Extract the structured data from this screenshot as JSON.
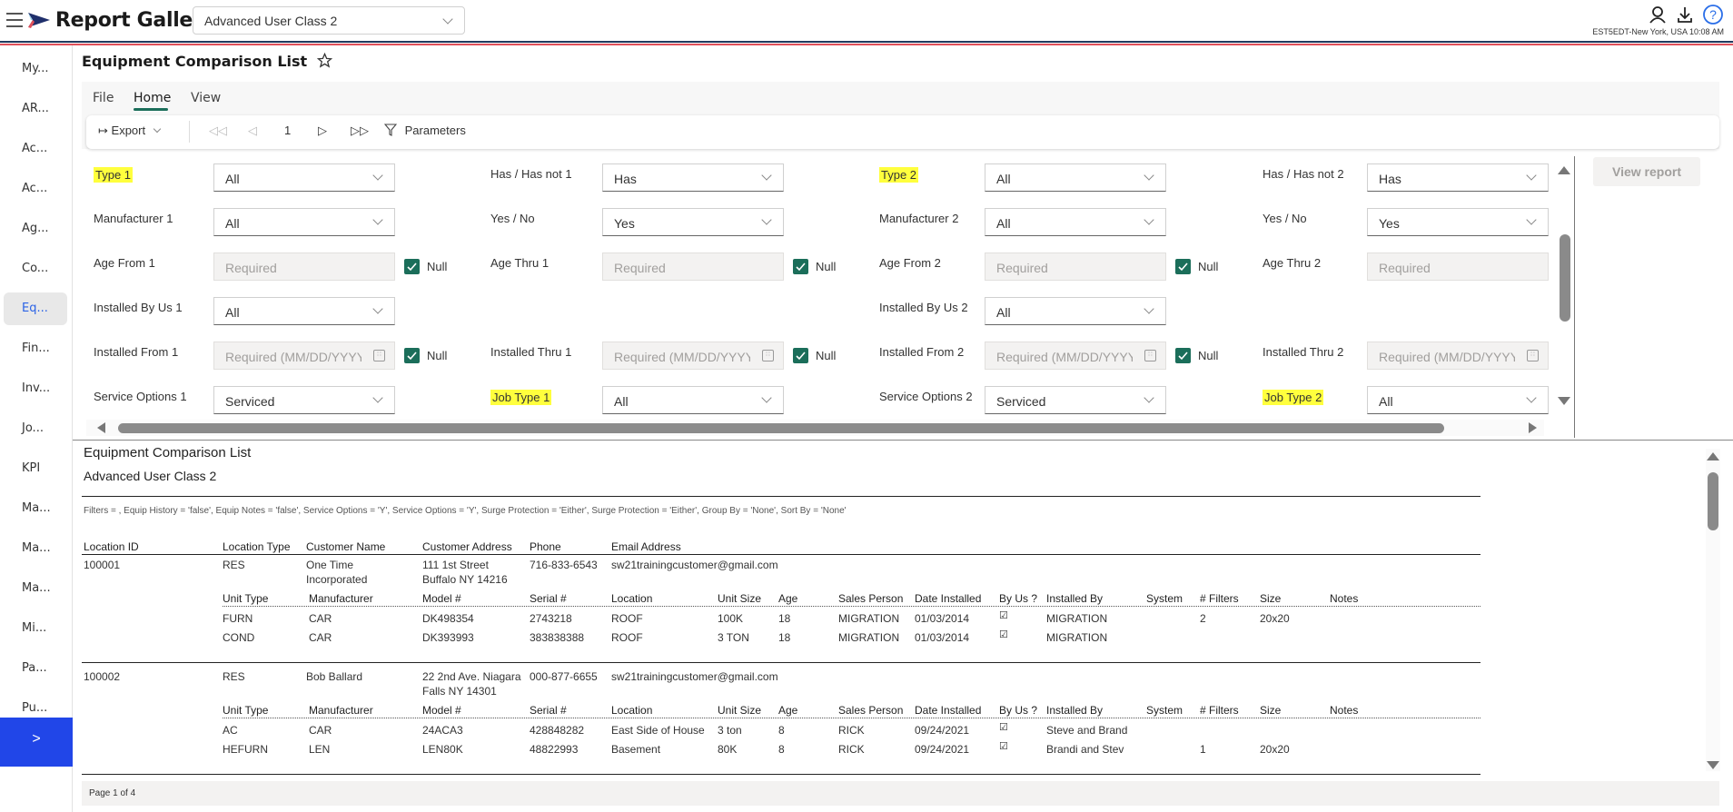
{
  "header": {
    "app_title": "Report Gallery",
    "report_select_value": "Advanced User Class 2",
    "timezone_clock": "EST5EDT-New York, USA 10:08 AM",
    "icons": [
      "user-icon",
      "download-icon",
      "help-icon"
    ],
    "accent_color": "#2146e8"
  },
  "sidebar": {
    "items": [
      {
        "label": "My..."
      },
      {
        "label": "AR..."
      },
      {
        "label": "Ac..."
      },
      {
        "label": "Ac..."
      },
      {
        "label": "Ag..."
      },
      {
        "label": "Co..."
      },
      {
        "label": "Eq...",
        "active": true
      },
      {
        "label": "Fin..."
      },
      {
        "label": "Inv..."
      },
      {
        "label": "Jo..."
      },
      {
        "label": "KPI"
      },
      {
        "label": "Ma..."
      },
      {
        "label": "Ma..."
      },
      {
        "label": "Ma..."
      },
      {
        "label": "Mi..."
      },
      {
        "label": "Pa..."
      },
      {
        "label": "Pu..."
      }
    ],
    "expand_label": ">"
  },
  "page": {
    "title": "Equipment Comparison List",
    "tabs": [
      {
        "label": "File"
      },
      {
        "label": "Home",
        "active": true
      },
      {
        "label": "View"
      }
    ],
    "toolbar": {
      "export_label": "Export",
      "page_number": "1",
      "parameters_label": "Parameters"
    }
  },
  "params": {
    "rows": [
      [
        {
          "label": "Type 1",
          "highlight": true,
          "type": "select",
          "value": "All"
        },
        {
          "label": "Has / Has not 1",
          "type": "select",
          "value": "Has"
        },
        {
          "label": "Type 2",
          "highlight": true,
          "type": "select",
          "value": "All"
        },
        {
          "label": "Has / Has not 2",
          "type": "select",
          "value": "Has"
        }
      ],
      [
        {
          "label": "Manufacturer 1",
          "type": "select",
          "value": "All"
        },
        {
          "label": "Yes / No",
          "type": "select",
          "value": "Yes"
        },
        {
          "label": "Manufacturer 2",
          "type": "select",
          "value": "All"
        },
        {
          "label": "Yes / No",
          "type": "select",
          "value": "Yes"
        }
      ],
      [
        {
          "label": "Age From 1",
          "type": "text",
          "placeholder": "Required",
          "null_checked": true
        },
        {
          "label": "Age Thru 1",
          "type": "text",
          "placeholder": "Required",
          "null_checked": true
        },
        {
          "label": "Age From 2",
          "type": "text",
          "placeholder": "Required",
          "null_checked": true
        },
        {
          "label": "Age Thru 2",
          "type": "text",
          "placeholder": "Required",
          "null_checked": true
        }
      ],
      [
        {
          "label": "Installed By Us 1",
          "type": "select",
          "value": "All"
        },
        null,
        {
          "label": "Installed By Us 2",
          "type": "select",
          "value": "All"
        },
        null
      ],
      [
        {
          "label": "Installed From 1",
          "type": "date",
          "placeholder": "Required (MM/DD/YYYY)",
          "null_checked": true
        },
        {
          "label": "Installed Thru 1",
          "type": "date",
          "placeholder": "Required (MM/DD/YYYY)",
          "null_checked": true
        },
        {
          "label": "Installed From 2",
          "type": "date",
          "placeholder": "Required (MM/DD/YYYY)",
          "null_checked": true
        },
        {
          "label": "Installed Thru 2",
          "type": "date",
          "placeholder": "Required (MM/DD/YYYY)",
          "null_checked": true
        }
      ],
      [
        {
          "label": "Service Options 1",
          "type": "select",
          "value": "Serviced"
        },
        {
          "label": "Job Type 1",
          "highlight": true,
          "type": "select",
          "value": "All"
        },
        {
          "label": "Service Options 2",
          "type": "select",
          "value": "Serviced"
        },
        {
          "label": "Job Type 2",
          "highlight": true,
          "type": "select",
          "value": "All"
        }
      ]
    ],
    "null_label": "Null",
    "view_report_label": "View report"
  },
  "report": {
    "title": "Equipment Comparison List",
    "subtitle": "Advanced User Class 2",
    "filters_text": "Filters = , Equip History = 'false', Equip Notes = 'false', Service Options = 'Y', Service Options = 'Y', Surge Protection = 'Either', Surge Protection = 'Either', Group By = 'None', Sort By = 'None'",
    "location_headers": [
      "Location ID",
      "Location Type",
      "Customer Name",
      "Customer Address",
      "Phone",
      "Email Address"
    ],
    "unit_headers": [
      "Unit Type",
      "Manufacturer",
      "Model #",
      "Serial #",
      "Location",
      "Unit Size",
      "Age",
      "Sales Person",
      "Date Installed",
      "By Us ?",
      "Installed By",
      "System",
      "# Filters",
      "Size",
      "Notes"
    ],
    "locations": [
      {
        "id": "100001",
        "type": "RES",
        "name_lines": [
          "One Time",
          "Incorporated"
        ],
        "address_lines": [
          "111 1st Street",
          "Buffalo NY 14216"
        ],
        "phone": "716-833-6543",
        "email": "sw21trainingcustomer@gmail.com",
        "units": [
          [
            "FURN",
            "CAR",
            "DK498354",
            "2743218",
            "ROOF",
            "100K",
            "18",
            "MIGRATION",
            "01/03/2014",
            "☑",
            "MIGRATION",
            "",
            "2",
            "20x20",
            ""
          ],
          [
            "COND",
            "CAR",
            "DK393993",
            "383838388",
            "ROOF",
            "3 TON",
            "18",
            "MIGRATION",
            "01/03/2014",
            "☑",
            "MIGRATION",
            "",
            "",
            "",
            ""
          ]
        ]
      },
      {
        "id": "100002",
        "type": "RES",
        "name_lines": [
          "Bob Ballard"
        ],
        "address_lines": [
          "22 2nd Ave. Niagara",
          "Falls NY 14301"
        ],
        "phone": "000-877-6655",
        "email": "sw21trainingcustomer@gmail.com",
        "units": [
          [
            "AC",
            "CAR",
            "24ACA3",
            "428848282",
            "East Side of House",
            "3 ton",
            "8",
            "RICK",
            "09/24/2021",
            "☑",
            "Steve and Brand",
            "",
            "",
            "",
            ""
          ],
          [
            "HEFURN",
            "LEN",
            "LEN80K",
            "48822993",
            "Basement",
            "80K",
            "8",
            "RICK",
            "09/24/2021",
            "☑",
            "Brandi and Stev",
            "",
            "1",
            "20x20",
            ""
          ]
        ]
      }
    ],
    "page_status": "Page 1 of 4"
  }
}
